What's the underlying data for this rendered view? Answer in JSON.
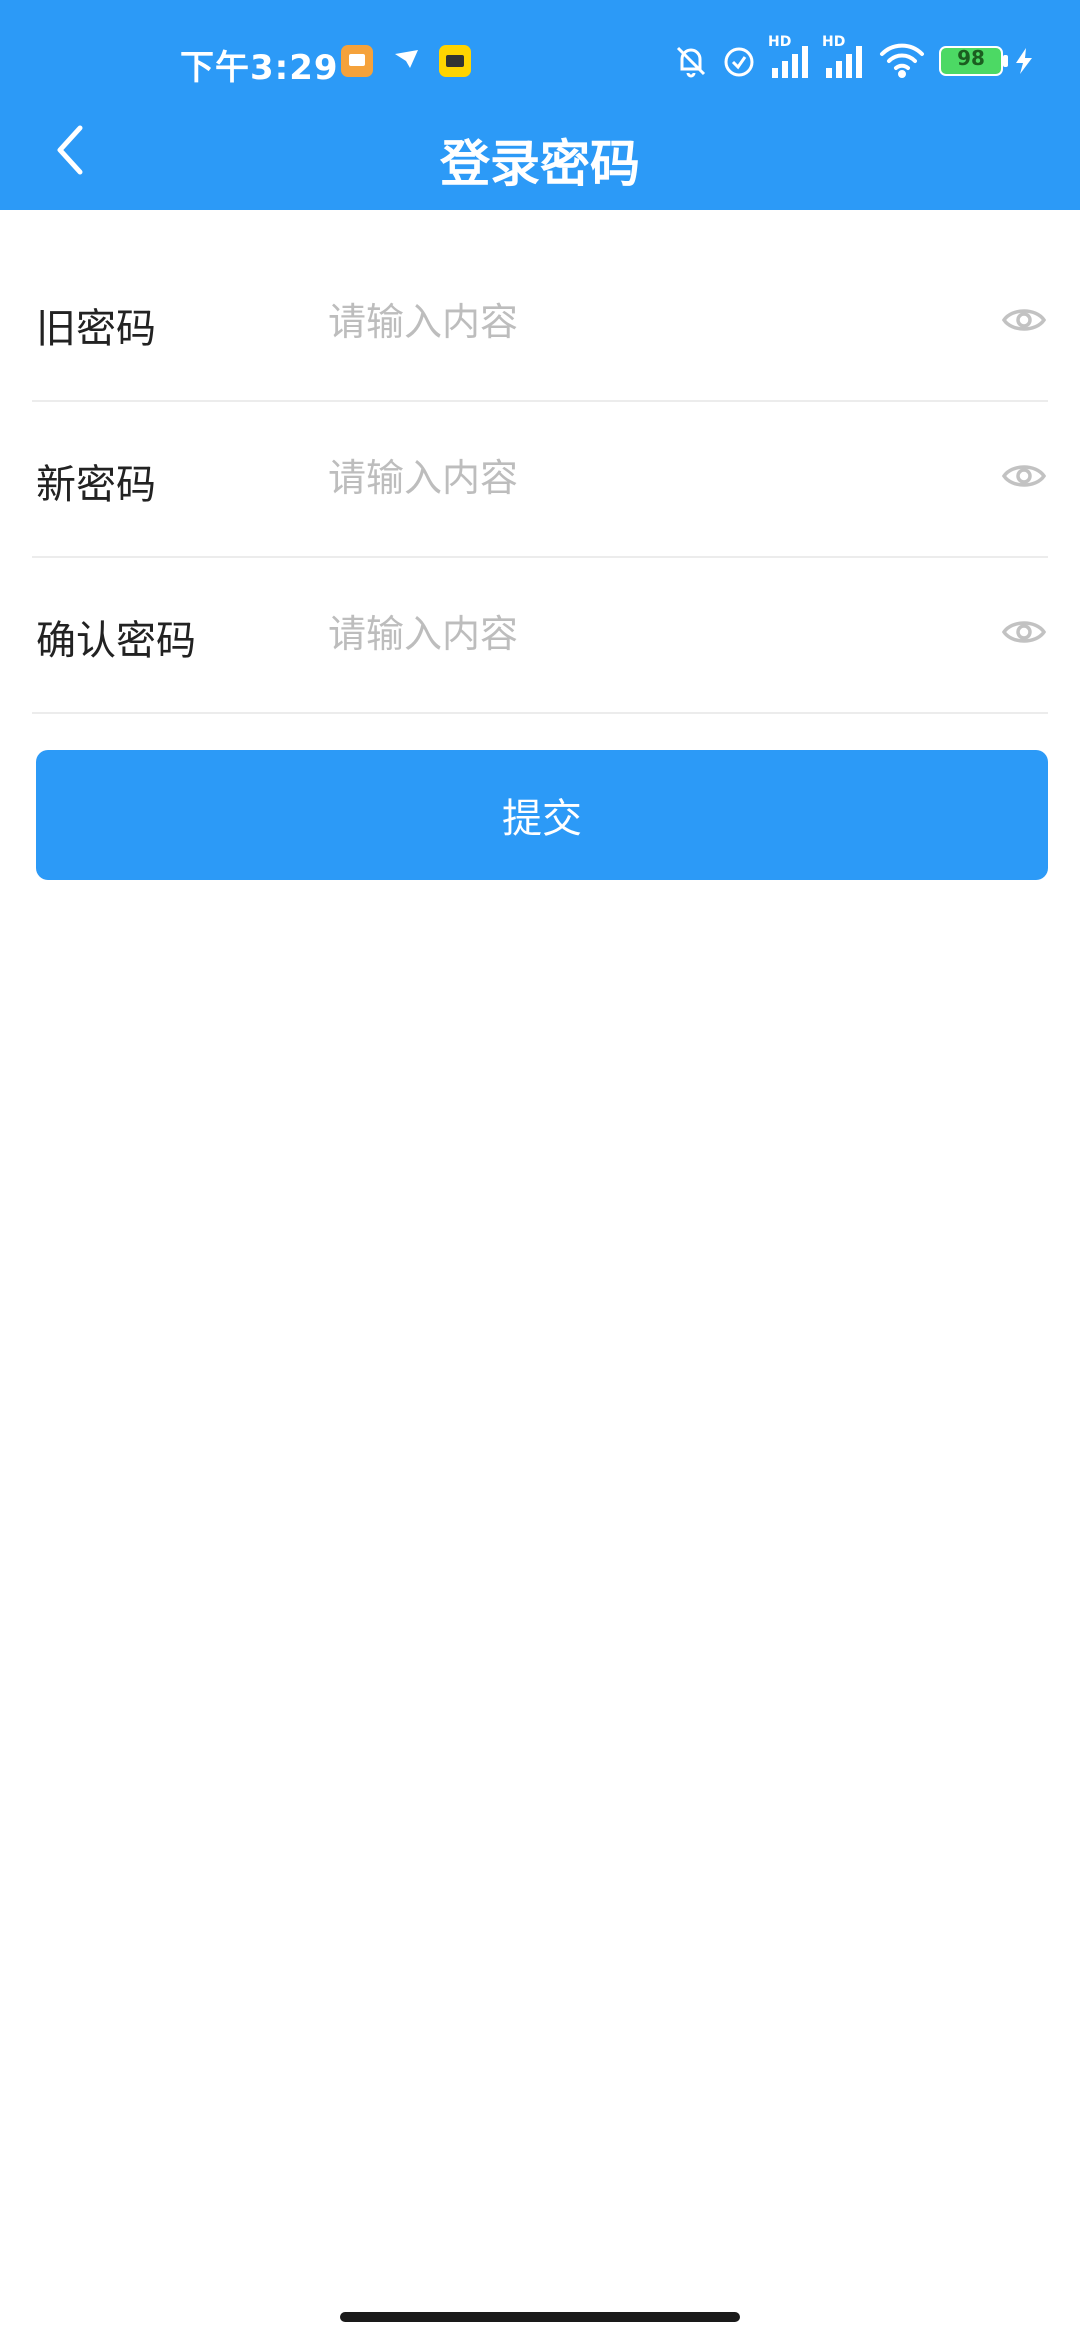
{
  "status_bar": {
    "time": "下午3:29",
    "battery_level": "98",
    "network_label_1": "HD",
    "network_label_2": "HD",
    "colors": {
      "app_icon_orange": "#F5A23B",
      "app_icon_yellow": "#FFD400",
      "battery_green": "#4CD964"
    }
  },
  "header": {
    "title": "登录密码",
    "back_icon": "chevron-left-icon",
    "background_color": "#2C9AF7"
  },
  "form": {
    "rows": [
      {
        "label": "旧密码",
        "placeholder": "请输入内容",
        "value": "",
        "icon": "eye-icon"
      },
      {
        "label": "新密码",
        "placeholder": "请输入内容",
        "value": "",
        "icon": "eye-icon"
      },
      {
        "label": "确认密码",
        "placeholder": "请输入内容",
        "value": "",
        "icon": "eye-icon"
      }
    ]
  },
  "submit": {
    "label": "提交",
    "color": "#2C9AF7"
  }
}
